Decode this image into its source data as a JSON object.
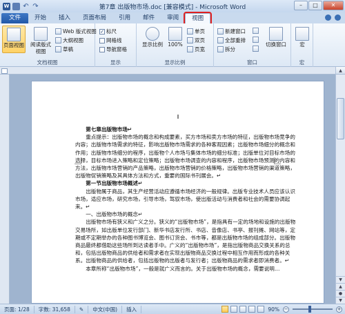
{
  "window": {
    "title": "第7章 出版物市场.doc [兼容模式] - Microsoft Word",
    "word_icon": "W",
    "min": "–",
    "max": "□",
    "close": "✕"
  },
  "tabs": [
    {
      "label": "文件"
    },
    {
      "label": "开始"
    },
    {
      "label": "插入"
    },
    {
      "label": "页面布局"
    },
    {
      "label": "引用"
    },
    {
      "label": "邮件"
    },
    {
      "label": "审阅"
    },
    {
      "label": "视图"
    }
  ],
  "ribbon": {
    "views": {
      "print_layout": "页面视图",
      "reading": "阅读版式\n视图",
      "web": "Web 版式视图",
      "outline": "大纲视图",
      "draft": "草稿",
      "label": "文档视图"
    },
    "show": {
      "ruler": "标尺",
      "gridlines": "网格线",
      "nav_pane": "导航窗格",
      "label": "显示",
      "ruler_checked": "✓"
    },
    "zoom": {
      "zoom": "显示比例",
      "percent": "100%",
      "label": "显示比例"
    },
    "pages": {
      "one": "单页",
      "two": "双页",
      "width": "页宽"
    },
    "window": {
      "new": "新建窗口",
      "arrange": "全部重排",
      "split": "拆分",
      "switch": "切换窗口",
      "label": "窗口"
    },
    "macro": {
      "macro": "宏",
      "label": "宏"
    }
  },
  "document": {
    "paragraphs": [
      {
        "text": "第七章出版物市场↵",
        "style": "h ind"
      },
      {
        "text": "重点提示：出版物市场的概念和构成要素，买方市场和卖方市场的特征，出版物市场竞争的内容；出版物市场需求的特征，影响出版物市场需求的各种客观因素；出版物市场细分的概念和作用；出版物市场细分的程序，出版物个人市场与集体市场的细分标准；出版单位对目标市场的选择，目标市场进入策略和定位策略；出版物市场调查的内容和程序，出版物市场预测的内容和方法，出版物市场营销的产品策略，出版物市场营销的价格策略，出版物市场营销的渠道策略，出版物促销策略及其具体方法和方式，重要的国际书刊展会。↵",
        "style": "ind"
      },
      {
        "text": "第一节出版物市场概述↵",
        "style": "h ind"
      },
      {
        "text": "出版物属于商品，其生产经营活动应遵循市场经济的一般规律。出版专业技术人员应该认识市场，适应市场，研究市场，引导市场，驾驭市场，使出版活动与消费者和社会的需要协调起来。↵",
        "style": "ind"
      },
      {
        "text": "一、出版物市场的概念↵",
        "style": "ind"
      },
      {
        "text": "出版物市场有狭义和广义之分。狭义的“出版物市场”，是指具有一定的场地和设施的出版物交易场所，如出版单位发行部门、新华书店发行所、书店、音像店、书亭、报刊摊、网站等，定期或不定期举办的各种图书博览会、图书订货会、书市等，都是出版物市场的组成部分。出版物商品最终都借助这些场所到达读者手中。广义的“出版物市场”，是指出版物商品交换关系的总和，包括出版物商品的供给者和需求者在实现出版物商品交换过程中相互作用而形成的各种关系。出版物商品的供给者，包括出版物的出版者与发行者；出版物商品的需求者即消费者。↵",
        "style": "ind"
      },
      {
        "text": "本章所称“出版物市场”，一般是就广义而言的。关于出版物市场的概念，需要说明…",
        "style": "ind"
      }
    ]
  },
  "status": {
    "page": "页面: 1/28",
    "words": "字数: 31,658",
    "lang": "中文(中国)",
    "mode": "插入",
    "zoom": "90%",
    "zoom_minus": "−",
    "zoom_plus": "+",
    "zoom_level": 0.9
  },
  "scroll": {
    "up": "▲",
    "down": "▼",
    "prev": "▲",
    "browse": "●",
    "next": "▼"
  }
}
